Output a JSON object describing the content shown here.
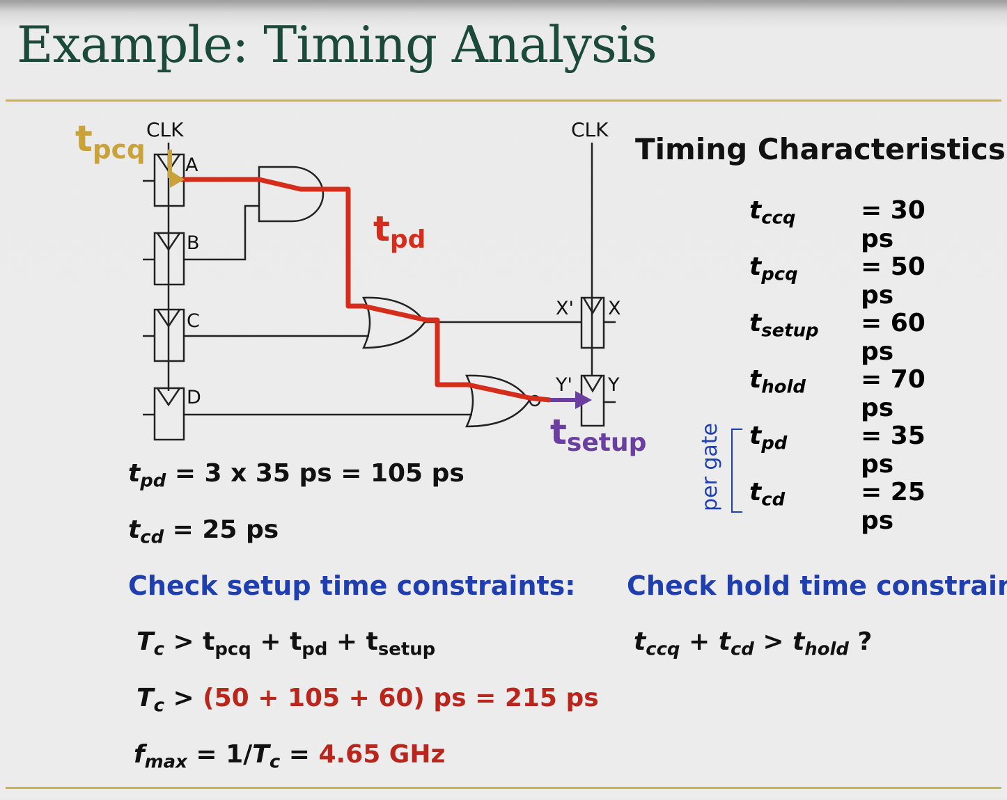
{
  "title": "Example: Timing Analysis",
  "circuit": {
    "clk_left": "CLK",
    "clk_right": "CLK",
    "reg_a": "A",
    "reg_b": "B",
    "reg_c": "C",
    "reg_d": "D",
    "x_in": "X'",
    "x_out": "X",
    "y_in": "Y'",
    "y_out": "Y",
    "label_tpcq": {
      "base": "t",
      "sub": "pcq"
    },
    "label_tpd": {
      "base": "t",
      "sub": "pd"
    },
    "label_tsetup": {
      "base": "t",
      "sub": "setup"
    }
  },
  "characteristics": {
    "heading": "Timing Characteristics",
    "rows": [
      {
        "base": "t",
        "sub": "ccq",
        "value": "= 30 ps"
      },
      {
        "base": "t",
        "sub": "pcq",
        "value": "= 50 ps"
      },
      {
        "base": "t",
        "sub": "setup",
        "value": "= 60 ps"
      },
      {
        "base": "t",
        "sub": "hold",
        "value": "= 70 ps"
      },
      {
        "base": "t",
        "sub": "pd",
        "value": "= 35 ps"
      },
      {
        "base": "t",
        "sub": "cd",
        "value": "= 25 ps"
      }
    ],
    "per_gate": "per gate"
  },
  "results": {
    "tpd": {
      "base": "t",
      "sub": "pd",
      "value": " = 3 x 35 ps = 105 ps"
    },
    "tcd": {
      "base": "t",
      "sub": "cd",
      "value": " = 25 ps"
    }
  },
  "setup": {
    "heading": "Check setup time constraints:",
    "eq1": {
      "lhs": "T",
      "lhs_sub": "c",
      "op": " > ",
      "t1": "t",
      "t1_sub": "pcq",
      "plus1": " + ",
      "t2": "t",
      "t2_sub": "pd",
      "plus2": " + ",
      "t3": "t",
      "t3_sub": "setup"
    },
    "eq2": {
      "lhs": "T",
      "lhs_sub": "c",
      "op": " > ",
      "rhs": "(50 + 105 + 60) ps = 215 ps"
    },
    "eq3": {
      "lhs": "f",
      "lhs_sub": "max",
      "mid": " = 1/",
      "tc": "T",
      "tc_sub": "c",
      "eq": " = ",
      "rhs": "4.65 GHz"
    }
  },
  "hold": {
    "heading": "Check hold time constraints:",
    "eq1": {
      "t1": "t",
      "t1_sub": "ccq",
      "plus": " + ",
      "t2": "t",
      "t2_sub": "cd",
      "op": " > ",
      "t3": "t",
      "t3_sub": "hold",
      "q": " ?"
    }
  },
  "colors": {
    "accent_rule": "#c8b44a",
    "critical_path": "#d42d1c",
    "tpcq": "#c9a23a",
    "tsetup": "#6a3fa0",
    "heading_blue": "#1f3fb0",
    "result_red": "#b8261c"
  }
}
